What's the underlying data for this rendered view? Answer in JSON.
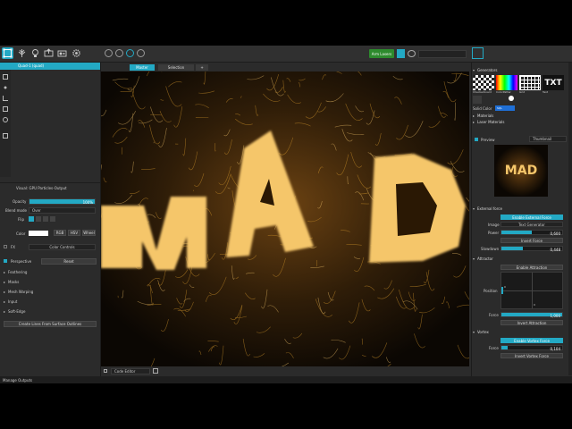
{
  "toolbar": {
    "green_button": "Arm Lasers"
  },
  "layers": {
    "quad_label": "Quad-1 (quad)"
  },
  "viewport_tabs": {
    "master": "Master",
    "selection": "Selection",
    "add": "+"
  },
  "visual": {
    "header": "Visual: GPU Particles-Output",
    "opacity_label": "Opacity",
    "opacity_value": "100%",
    "opacity_fraction": 1.0,
    "blend_label": "Blend mode",
    "blend_value": "Over",
    "flip_label": "Flip",
    "color_label": "Color",
    "rgb": "RGB",
    "hsv": "HSV",
    "wheel": "Wheel",
    "fx_label": "FX",
    "fx_value": "Color Controls",
    "perspective_label": "Perspective",
    "reset_label": "Reset",
    "sections": [
      "Feathering",
      "Masks",
      "Mesh Warping",
      "Input",
      "Soft-Edge"
    ],
    "create_lines": "Create Lines From Surface Outlines"
  },
  "bottom_bar": {
    "code_editor": "Code Editor"
  },
  "status_bar": {
    "text": "Manage Outputs"
  },
  "right": {
    "generators_title": "Generators",
    "gen_items": [
      "Checkerboard",
      "ColorPatter",
      "Grid",
      "Text"
    ],
    "gen_text_glyph": "TXT",
    "solid_color_label": "Solid Color",
    "solid_color_value": "SQL",
    "materials": "Materials",
    "laser_materials": "Laser Materials",
    "preview_label": "Preview",
    "preview_mode": "Thumbnail",
    "preview_text": "MAD",
    "external_force_title": "External force",
    "enable_external_force": "Enable External Force",
    "image_label": "Image",
    "image_value": "Text Generator",
    "power_label": "Power",
    "power_value": "0,600",
    "power_fraction": 0.5,
    "invert_force": "Invert Force",
    "slowdown_label": "Slowdown",
    "slowdown_value": "0,448",
    "slowdown_fraction": 0.35,
    "attractor_title": "Attractor",
    "enable_attraction": "Enable Attraction",
    "position_label": "Position",
    "position_y_tick": "0",
    "position_x_tick": "0",
    "force_label": "Force",
    "force_value": "1,000",
    "force_fraction": 1.0,
    "invert_attraction": "Invert Attraction",
    "vortex_title": "Vortex",
    "enable_vortex": "Enable Vortex Force",
    "vortex_force_label": "Force",
    "vortex_force_value": "0,104",
    "vortex_force_fraction": 0.1,
    "invert_vortex": "Invert Vortex Force"
  },
  "colors": {
    "accent": "#23a9c4",
    "green": "#2d8a2d",
    "panel": "#2b2b2b",
    "particle_gold": "#e8a020"
  }
}
